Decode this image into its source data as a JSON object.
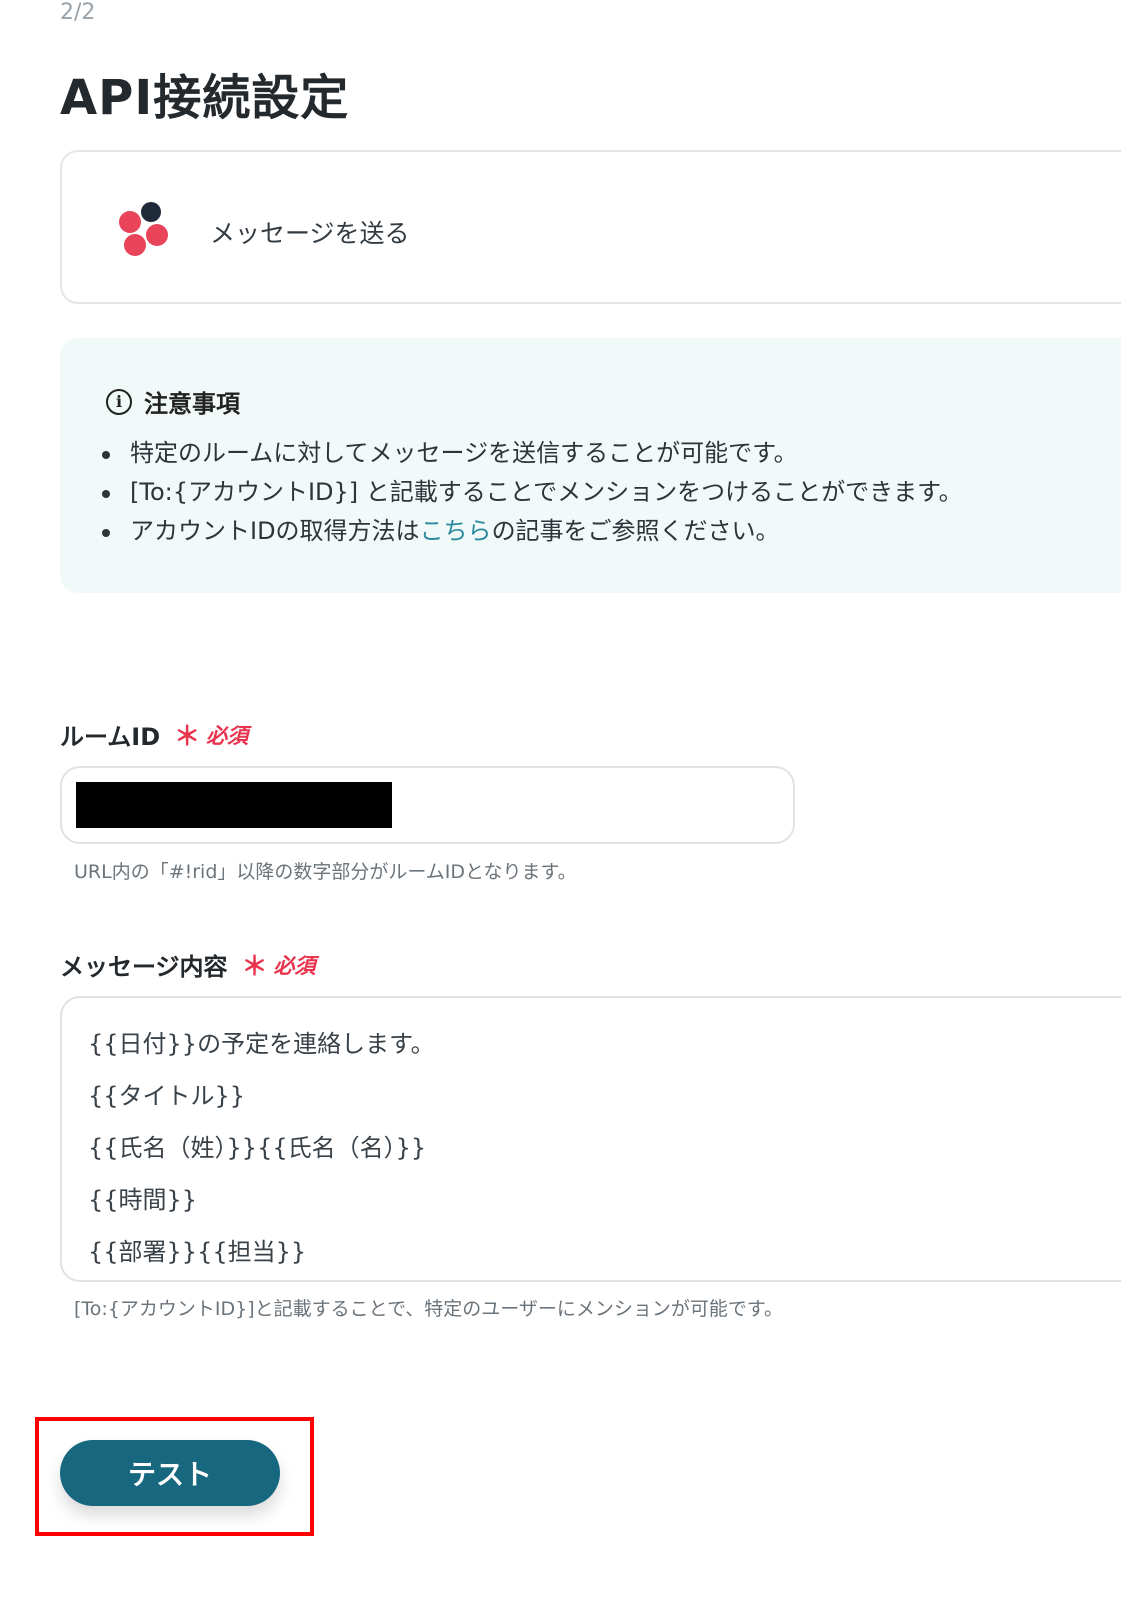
{
  "page": {
    "step": "2/2",
    "title": "API接続設定"
  },
  "app_card": {
    "action_label": "メッセージを送る",
    "logo_icon": "chatwork-logo-icon"
  },
  "notice": {
    "icon": "info-icon",
    "icon_glyph": "i",
    "title": "注意事項",
    "items": [
      "特定のルームに対してメッセージを送信することが可能です。",
      "[To:{アカウントID}] と記載することでメンションをつけることができます。"
    ],
    "item3": {
      "before": "アカウントIDの取得方法は",
      "link": "こちら",
      "after": "の記事をご参照ください。"
    }
  },
  "required": {
    "star": "＊",
    "label": "必須"
  },
  "room_id": {
    "label": "ルームID",
    "hint": "URL内の「#!rid」以降の数字部分がルームIDとなります。"
  },
  "message": {
    "label": "メッセージ内容",
    "lines": [
      "{{日付}}の予定を連絡します。",
      "{{タイトル}}",
      "{{氏名（姓）}}{{氏名（名）}}",
      "{{時間}}",
      "{{部署}}{{担当}}"
    ],
    "hint": "[To:{アカウントID}]と記載することで、特定のユーザーにメンションが可能です。"
  },
  "test_button": {
    "label": "テスト"
  },
  "colors": {
    "accent": "#17677f",
    "link": "#2b8aa0",
    "required": "#e8344e",
    "notice_bg": "#f1f9f9",
    "highlight": "#ff0000"
  }
}
